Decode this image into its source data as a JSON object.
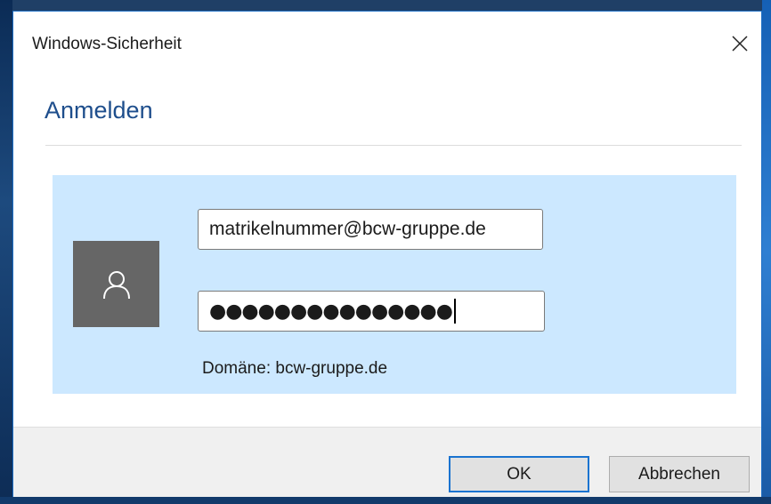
{
  "window": {
    "title": "Windows-Sicherheit"
  },
  "icons": {
    "close": "close-icon",
    "user": "user-avatar-icon"
  },
  "heading": "Anmelden",
  "credentials": {
    "username_value": "matrikelnummer@bcw-gruppe.de",
    "password_masked": "●●●●●●●●●●●●●●●",
    "domain_text": "Domäne: bcw-gruppe.de"
  },
  "buttons": {
    "ok_label": "OK",
    "cancel_label": "Abbrechen"
  },
  "colors": {
    "accent": "#1a73d0",
    "heading": "#1e4e8c",
    "panel": "#cce8ff",
    "avatar_bg": "#666666"
  }
}
